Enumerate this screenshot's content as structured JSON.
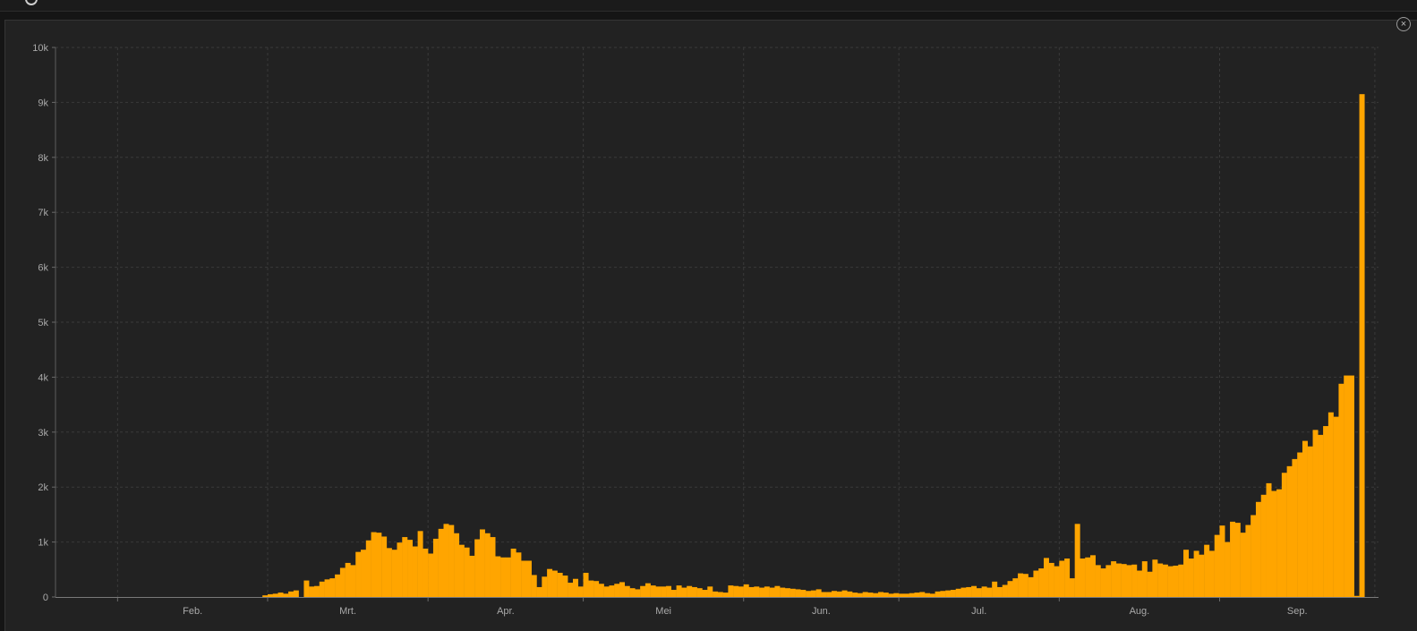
{
  "header": {
    "title": ""
  },
  "icons": {
    "info": "info-icon",
    "close": "close-icon"
  },
  "colors": {
    "background": "#222222",
    "bar": "#FFA500",
    "grid": "#3a3a3a",
    "axis_text": "#a9a9a9"
  },
  "chart_data": {
    "type": "bar",
    "title": "",
    "xlabel": "",
    "ylabel": "",
    "ylim": [
      0,
      10000
    ],
    "grid": true,
    "y_ticks": [
      0,
      1000,
      2000,
      3000,
      4000,
      5000,
      6000,
      7000,
      8000,
      9000,
      10000
    ],
    "y_tick_labels": [
      "0",
      "1k",
      "2k",
      "3k",
      "4k",
      "5k",
      "6k",
      "7k",
      "8k",
      "9k",
      "10k"
    ],
    "x_tick_labels": [
      "Feb.",
      "Mrt.",
      "Apr.",
      "Mei",
      "Jun.",
      "Jul.",
      "Aug.",
      "Sep."
    ],
    "x_start": "2020-01-20",
    "values": [
      0,
      0,
      0,
      0,
      0,
      0,
      0,
      0,
      0,
      0,
      0,
      0,
      0,
      0,
      0,
      0,
      0,
      0,
      0,
      0,
      0,
      0,
      0,
      0,
      0,
      0,
      0,
      0,
      0,
      0,
      0,
      0,
      0,
      0,
      0,
      0,
      0,
      0,
      0,
      0,
      30,
      50,
      60,
      80,
      60,
      100,
      120,
      0,
      300,
      190,
      200,
      280,
      320,
      340,
      410,
      530,
      620,
      580,
      820,
      860,
      1030,
      1180,
      1170,
      1100,
      890,
      860,
      990,
      1090,
      1040,
      920,
      1200,
      880,
      790,
      1060,
      1240,
      1330,
      1310,
      1160,
      950,
      900,
      750,
      1050,
      1230,
      1160,
      1090,
      740,
      720,
      720,
      880,
      810,
      660,
      660,
      400,
      180,
      370,
      510,
      480,
      440,
      390,
      260,
      330,
      190,
      440,
      300,
      290,
      240,
      190,
      210,
      240,
      270,
      200,
      160,
      140,
      200,
      250,
      210,
      190,
      190,
      200,
      130,
      210,
      170,
      200,
      180,
      160,
      130,
      190,
      100,
      90,
      80,
      210,
      200,
      190,
      230,
      180,
      190,
      170,
      190,
      170,
      200,
      170,
      160,
      150,
      140,
      130,
      110,
      120,
      140,
      90,
      90,
      110,
      100,
      120,
      100,
      80,
      70,
      90,
      80,
      70,
      90,
      80,
      60,
      70,
      60,
      60,
      70,
      80,
      90,
      70,
      60,
      100,
      110,
      120,
      130,
      150,
      170,
      180,
      200,
      160,
      190,
      170,
      280,
      180,
      220,
      290,
      340,
      430,
      420,
      360,
      480,
      520,
      710,
      620,
      560,
      660,
      700,
      340,
      1330,
      700,
      720,
      760,
      580,
      520,
      580,
      650,
      610,
      600,
      580,
      590,
      480,
      650,
      460,
      680,
      610,
      590,
      560,
      570,
      590,
      860,
      700,
      840,
      770,
      950,
      840,
      1130,
      1300,
      1000,
      1370,
      1350,
      1170,
      1310,
      1490,
      1730,
      1860,
      2070,
      1930,
      1960,
      2260,
      2380,
      2510,
      2630,
      2840,
      2740,
      3040,
      2950,
      3110,
      3360,
      3280,
      3880,
      4030,
      4030,
      20,
      9150
    ]
  }
}
